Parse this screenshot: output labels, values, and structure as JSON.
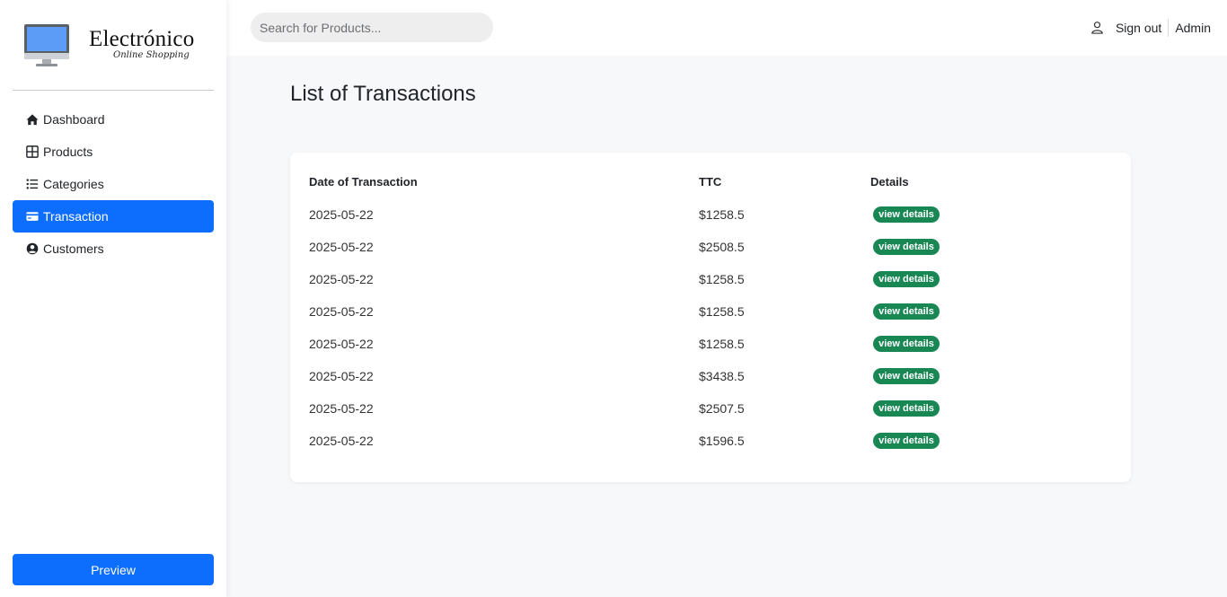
{
  "brand": {
    "title": "Electrónico",
    "subtitle": "Online Shopping",
    "icon": "computer-monitor-icon"
  },
  "sidebar": {
    "items": [
      {
        "label": "Dashboard",
        "icon": "home-icon",
        "active": false
      },
      {
        "label": "Products",
        "icon": "grid-icon",
        "active": false
      },
      {
        "label": "Categories",
        "icon": "list-icon",
        "active": false
      },
      {
        "label": "Transaction",
        "icon": "credit-card-icon",
        "active": true
      },
      {
        "label": "Customers",
        "icon": "person-circle-icon",
        "active": false
      }
    ],
    "preview_label": "Preview"
  },
  "header": {
    "search_placeholder": "Search for Products...",
    "signout_label": "Sign out",
    "admin_label": "Admin"
  },
  "main": {
    "title": "List of Transactions",
    "columns": [
      "Date of Transaction",
      "TTC",
      "Details"
    ],
    "rows": [
      {
        "date": "2025-05-22",
        "ttc": "$1258.5",
        "details": "view details"
      },
      {
        "date": "2025-05-22",
        "ttc": "$2508.5",
        "details": "view details"
      },
      {
        "date": "2025-05-22",
        "ttc": "$1258.5",
        "details": "view details"
      },
      {
        "date": "2025-05-22",
        "ttc": "$1258.5",
        "details": "view details"
      },
      {
        "date": "2025-05-22",
        "ttc": "$1258.5",
        "details": "view details"
      },
      {
        "date": "2025-05-22",
        "ttc": "$3438.5",
        "details": "view details"
      },
      {
        "date": "2025-05-22",
        "ttc": "$2507.5",
        "details": "view details"
      },
      {
        "date": "2025-05-22",
        "ttc": "$1596.5",
        "details": "view details"
      }
    ]
  },
  "colors": {
    "primary": "#0d6efd",
    "success": "#198754",
    "background": "#f7f8fa"
  }
}
